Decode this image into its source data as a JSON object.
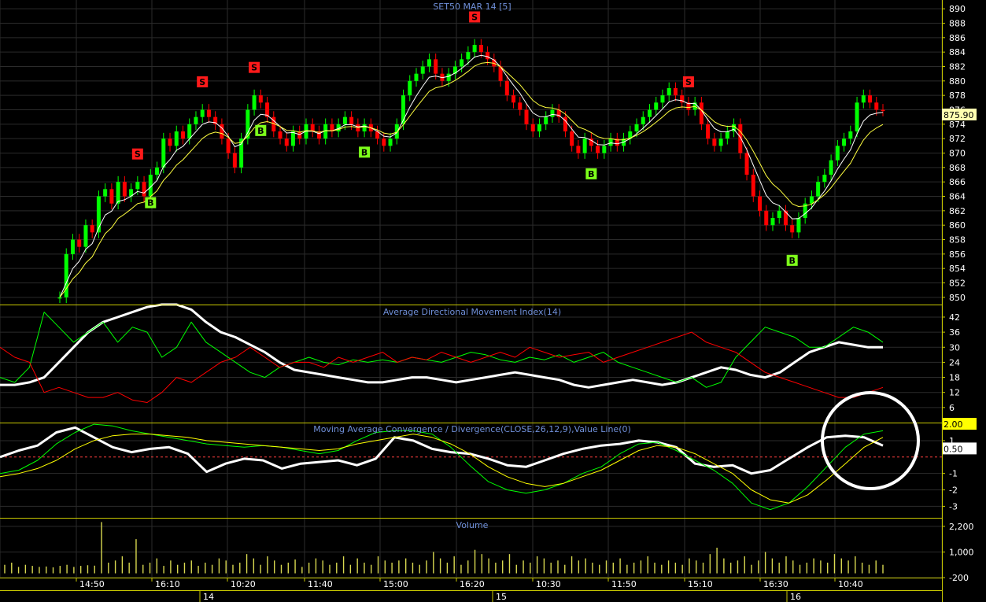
{
  "chart_data": [
    {
      "panel": "price",
      "type": "candlestick",
      "title": "SET50 MAR 14   [5]",
      "yticks": [
        850,
        852,
        854,
        856,
        858,
        860,
        862,
        864,
        866,
        868,
        870,
        872,
        874,
        876,
        878,
        880,
        882,
        884,
        886,
        888,
        890
      ],
      "ylim": [
        849,
        891
      ],
      "last_value_label": "875.90",
      "last_value": 875.9,
      "closes": [
        850,
        856,
        858,
        857,
        860,
        859,
        864,
        865,
        863,
        866,
        864,
        865,
        866,
        864,
        867,
        868,
        872,
        871,
        873,
        872,
        874,
        875,
        876,
        875,
        874,
        872,
        870,
        868,
        872,
        876,
        878,
        877,
        875,
        873,
        872,
        871,
        873,
        872,
        874,
        873,
        872,
        874,
        873,
        874,
        875,
        874,
        873,
        874,
        873,
        872,
        871,
        872,
        874,
        878,
        880,
        881,
        882,
        883,
        881,
        880,
        881,
        882,
        883,
        884,
        885,
        884,
        883,
        882,
        880,
        878,
        877,
        876,
        874,
        873,
        874,
        875,
        876,
        875,
        873,
        871,
        870,
        872,
        871,
        870,
        871,
        872,
        871,
        872,
        873,
        874,
        875,
        876,
        877,
        878,
        879,
        878,
        877,
        876,
        877,
        874,
        872,
        871,
        872,
        873,
        874,
        870,
        867,
        864,
        862,
        860,
        861,
        862,
        860,
        859,
        861,
        863,
        864,
        866,
        867,
        869,
        871,
        872,
        873,
        877,
        878,
        877,
        876,
        875.9
      ],
      "markers": [
        {
          "label": "S",
          "type": "sell",
          "index": 12
        },
        {
          "label": "B",
          "type": "buy",
          "index": 14
        },
        {
          "label": "S",
          "type": "sell",
          "index": 22
        },
        {
          "label": "S",
          "type": "sell",
          "index": 30
        },
        {
          "label": "B",
          "type": "buy",
          "index": 31
        },
        {
          "label": "B",
          "type": "buy",
          "index": 47
        },
        {
          "label": "S",
          "type": "sell",
          "index": 64
        },
        {
          "label": "B",
          "type": "buy",
          "index": 82
        },
        {
          "label": "S",
          "type": "sell",
          "index": 97
        },
        {
          "label": "B",
          "type": "buy",
          "index": 113
        }
      ]
    },
    {
      "panel": "adx",
      "type": "line",
      "title": "Average Directional Movement Index(14)",
      "yticks": [
        6,
        12,
        18,
        24,
        30,
        36,
        42
      ],
      "ylim": [
        0,
        47
      ],
      "series": [
        {
          "color": "#ffffff",
          "values": [
            15,
            15,
            16,
            18,
            24,
            30,
            36,
            40,
            42,
            44,
            46,
            47,
            47,
            45,
            40,
            36,
            34,
            31,
            28,
            24,
            21,
            20,
            19,
            18,
            17,
            16,
            16,
            17,
            18,
            18,
            17,
            16,
            17,
            18,
            19,
            20,
            19,
            18,
            17,
            15,
            14,
            15,
            16,
            17,
            16,
            15,
            16,
            18,
            20,
            22,
            21,
            19,
            18,
            20,
            24,
            28,
            30,
            32,
            31,
            30,
            30
          ]
        },
        {
          "color": "#00ff00",
          "values": [
            18,
            16,
            22,
            44,
            38,
            32,
            36,
            40,
            32,
            38,
            36,
            26,
            30,
            40,
            32,
            28,
            24,
            20,
            18,
            22,
            24,
            26,
            24,
            23,
            25,
            24,
            25,
            24,
            26,
            25,
            24,
            26,
            28,
            27,
            25,
            24,
            26,
            25,
            27,
            24,
            26,
            28,
            24,
            22,
            20,
            18,
            16,
            18,
            14,
            16,
            26,
            32,
            38,
            36,
            34,
            30,
            30,
            34,
            38,
            36,
            32
          ]
        },
        {
          "color": "#ff0000",
          "values": [
            30,
            26,
            24,
            12,
            14,
            12,
            10,
            10,
            12,
            9,
            8,
            12,
            18,
            16,
            20,
            24,
            26,
            30,
            26,
            22,
            24,
            24,
            22,
            26,
            24,
            26,
            28,
            24,
            26,
            25,
            28,
            26,
            24,
            26,
            28,
            26,
            30,
            28,
            26,
            27,
            28,
            24,
            26,
            28,
            30,
            32,
            34,
            36,
            32,
            30,
            28,
            24,
            20,
            18,
            16,
            14,
            12,
            10,
            10,
            12,
            14
          ]
        }
      ]
    },
    {
      "panel": "macd",
      "type": "line",
      "title": "Moving Average Convergence / Divergence(CLOSE,26,12,9),Value Line(0)",
      "yticks": [
        -3,
        -2,
        -1,
        1
      ],
      "ylim": [
        -3.7,
        2.1
      ],
      "value_line": 0,
      "labels": [
        {
          "text": "2.00",
          "value": 2.0,
          "bg": "#ffff00",
          "fg": "#000000"
        },
        {
          "text": "0.50",
          "value": 0.5,
          "bg": "#ffffff",
          "fg": "#000000"
        }
      ],
      "series": [
        {
          "color": "#ffffff",
          "values": [
            0.0,
            0.4,
            0.7,
            1.5,
            1.8,
            1.2,
            0.6,
            0.3,
            0.5,
            0.6,
            0.2,
            -0.9,
            -0.4,
            -0.1,
            -0.2,
            -0.7,
            -0.4,
            -0.3,
            -0.2,
            -0.5,
            -0.1,
            1.2,
            1.0,
            0.5,
            0.3,
            0.2,
            -0.1,
            -0.5,
            -0.6,
            -0.2,
            0.2,
            0.5,
            0.7,
            0.8,
            1.0,
            0.9,
            0.6,
            -0.4,
            -0.6,
            -0.5,
            -1.0,
            -0.8,
            -0.1,
            0.6,
            1.2,
            1.3,
            1.2,
            0.7
          ]
        },
        {
          "color": "#00ff00",
          "values": [
            -1.0,
            -0.8,
            -0.2,
            0.8,
            1.5,
            2.0,
            1.9,
            1.6,
            1.4,
            1.2,
            1.0,
            0.8,
            0.7,
            0.6,
            0.7,
            0.6,
            0.4,
            0.2,
            0.4,
            1.0,
            1.5,
            1.6,
            1.6,
            1.4,
            0.6,
            -0.5,
            -1.5,
            -2.0,
            -2.2,
            -2.0,
            -1.6,
            -1.0,
            -0.6,
            0.2,
            0.8,
            0.9,
            0.4,
            -0.2,
            -0.8,
            -1.6,
            -2.8,
            -3.2,
            -2.8,
            -1.8,
            -0.6,
            0.6,
            1.4,
            1.6
          ]
        },
        {
          "color": "#ffff00",
          "values": [
            -1.2,
            -1.0,
            -0.7,
            -0.2,
            0.5,
            1.0,
            1.3,
            1.4,
            1.4,
            1.3,
            1.2,
            1.0,
            0.9,
            0.8,
            0.7,
            0.6,
            0.5,
            0.4,
            0.5,
            0.8,
            1.0,
            1.2,
            1.4,
            1.2,
            0.8,
            0.2,
            -0.6,
            -1.2,
            -1.6,
            -1.8,
            -1.6,
            -1.2,
            -0.8,
            -0.2,
            0.4,
            0.7,
            0.6,
            0.2,
            -0.4,
            -1.0,
            -2.0,
            -2.6,
            -2.8,
            -2.3,
            -1.4,
            -0.4,
            0.6,
            1.2
          ]
        }
      ]
    },
    {
      "panel": "volume",
      "type": "bar",
      "title": "Volume",
      "yticks": [
        -200,
        1000,
        2200
      ],
      "ytick_labels": [
        "-200",
        "1,000",
        "2,200"
      ],
      "ylim": [
        -200,
        2600
      ],
      "values": [
        400,
        500,
        300,
        400,
        350,
        300,
        320,
        280,
        350,
        400,
        300,
        350,
        380,
        360,
        2400,
        500,
        600,
        800,
        500,
        1600,
        400,
        500,
        700,
        350,
        600,
        400,
        500,
        600,
        350,
        500,
        400,
        700,
        600,
        400,
        500,
        900,
        700,
        400,
        800,
        600,
        400,
        500,
        650,
        300,
        500,
        700,
        600,
        400,
        500,
        800,
        400,
        700,
        500,
        400,
        800,
        600,
        500,
        600,
        700,
        500,
        400,
        600,
        1000,
        700,
        500,
        800,
        400,
        600,
        1100,
        900,
        700,
        500,
        600,
        900,
        400,
        600,
        500,
        800,
        700,
        500,
        600,
        400,
        800,
        600,
        700,
        500,
        400,
        600,
        500,
        700,
        400,
        500,
        600,
        800,
        500,
        400,
        600,
        500,
        400,
        700,
        600,
        500,
        900,
        1200,
        700,
        500,
        600,
        800,
        400,
        600,
        1000,
        700,
        500,
        800,
        600,
        400,
        500,
        700,
        600,
        500,
        900,
        700,
        600,
        800,
        500,
        400,
        600,
        400
      ]
    },
    {
      "panel": "x-axis",
      "time_labels": [
        "14:50",
        "16:10",
        "10:20",
        "11:40",
        "15:00",
        "16:20",
        "10:30",
        "11:50",
        "15:10",
        "16:30",
        "10:40"
      ],
      "date_labels": [
        "14",
        "15",
        "16"
      ]
    }
  ],
  "colors": {
    "up": "#00ff00",
    "down": "#ff0000",
    "title_text": "#6f8fd8",
    "divider": "#c8c800",
    "grid": "#2b2b2b",
    "value_line": "#ff4040",
    "last_label_bg": "#ffffb0",
    "ma_fast": "#ffff40",
    "ma_slow": "#ffffff"
  },
  "annotation": {
    "shape": "circle",
    "color": "#ffffff"
  }
}
